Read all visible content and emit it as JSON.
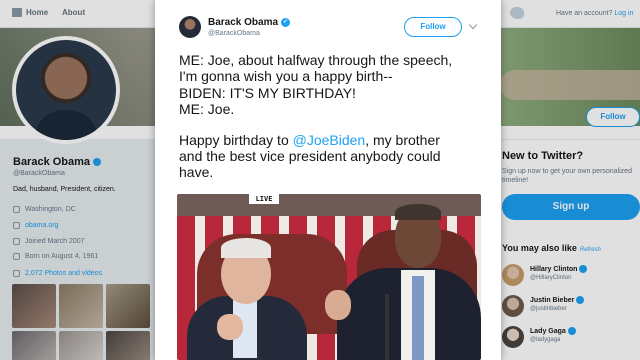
{
  "nav": {
    "home_label": "Home",
    "about_label": "About",
    "login_text": "Have an account?",
    "login_link": "Log in"
  },
  "profile": {
    "name": "Barack Obama",
    "handle": "@BarackObama",
    "bio": "Dad, husband, President, citizen.",
    "location": "Washington, DC",
    "website": "obama.org",
    "joined": "Joined March 2007",
    "born": "Born on August 4, 1961",
    "photos_label": "2,072 Photos and videos",
    "follow_label": "Follow"
  },
  "signup": {
    "title": "New to Twitter?",
    "subtitle": "Sign up now to get your own personalized timeline!",
    "button_label": "Sign up"
  },
  "suggestions": {
    "title": "You may also like",
    "refresh_label": "Refresh",
    "items": [
      {
        "name": "Hillary Clinton",
        "handle": "@HillaryClinton"
      },
      {
        "name": "Justin Bieber",
        "handle": "@justinbieber"
      },
      {
        "name": "Lady Gaga",
        "handle": "@ladygaga"
      }
    ]
  },
  "tweet": {
    "author_name": "Barack Obama",
    "author_handle": "@BarackObama",
    "follow_label": "Follow",
    "lines": [
      "ME:  Joe, about halfway through the speech,",
      "I'm gonna wish you a happy birth--",
      "BIDEN:  IT'S MY BIRTHDAY!",
      "ME:  Joe."
    ],
    "para2_line1_before": "Happy birthday to ",
    "mention": "@JoeBiden",
    "para2_line1_after": ", my brother",
    "para2_line2": "and the best vice president anybody could",
    "para2_line3": "have.",
    "gif_badge": "LIVE"
  },
  "colors": {
    "accent": "#1da1f2",
    "text": "#14171a",
    "muted": "#657786",
    "background": "#e6ecf0"
  }
}
